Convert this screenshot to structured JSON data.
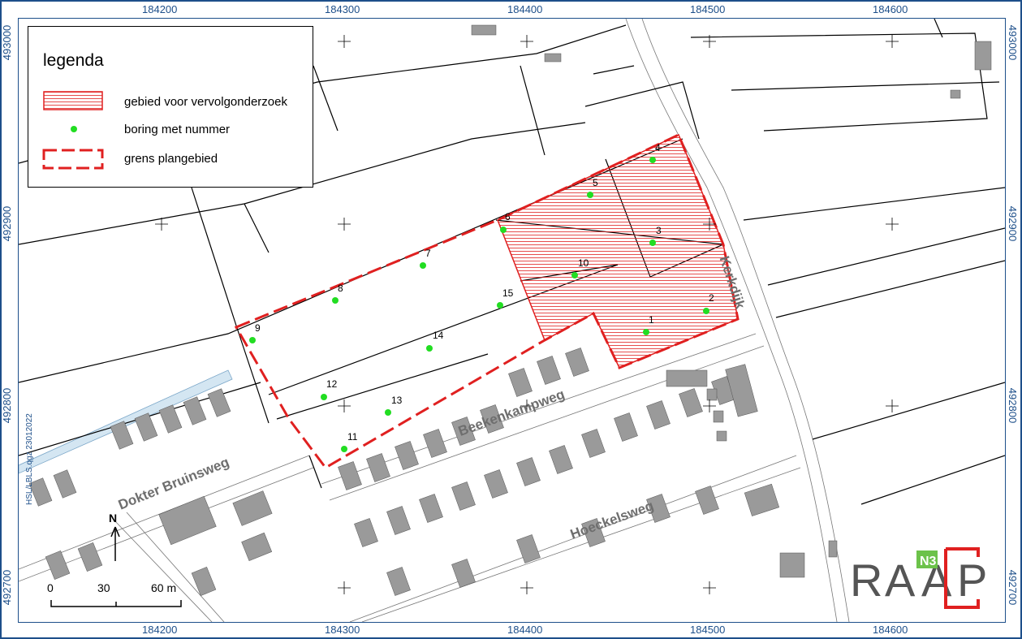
{
  "map": {
    "x_ticks_top": [
      "184200",
      "184300",
      "184400",
      "184500",
      "184600"
    ],
    "x_ticks_bottom": [
      "184200",
      "184300",
      "184400",
      "184500",
      "184600"
    ],
    "y_ticks_left": [
      "493000",
      "492900",
      "492800",
      "492700"
    ],
    "y_ticks_right": [
      "493000",
      "492900",
      "492800",
      "492700"
    ]
  },
  "legend": {
    "title": "legenda",
    "items": [
      {
        "symbol": "hatched-area",
        "label": "gebied voor vervolgonderzoek",
        "color": "#e02020"
      },
      {
        "symbol": "green-dot",
        "label": "boring met nummer",
        "color": "#22dd22"
      },
      {
        "symbol": "dashed-boundary",
        "label": "grens plangebied",
        "color": "#e02020"
      }
    ]
  },
  "borings": [
    "1",
    "2",
    "3",
    "4",
    "5",
    "6",
    "7",
    "8",
    "9",
    "10",
    "11",
    "12",
    "13",
    "14",
    "15"
  ],
  "streets": {
    "kerkdijk": "Kerkdijk",
    "beekenkampweg": "Beekenkampweg",
    "dokter_bruinsweg": "Dokter Bruinsweg",
    "hoeckelsweg": "Hoeckelsweg"
  },
  "scale": {
    "labels": [
      "0",
      "30",
      "60 m"
    ],
    "north": "N"
  },
  "credit": "HSL/LBLS.qgz 23012022",
  "logo": {
    "letters": [
      "R",
      "A",
      "A",
      "P"
    ],
    "badge": "N3",
    "brand_color": "#e02020",
    "badge_color": "#6cc24a"
  }
}
